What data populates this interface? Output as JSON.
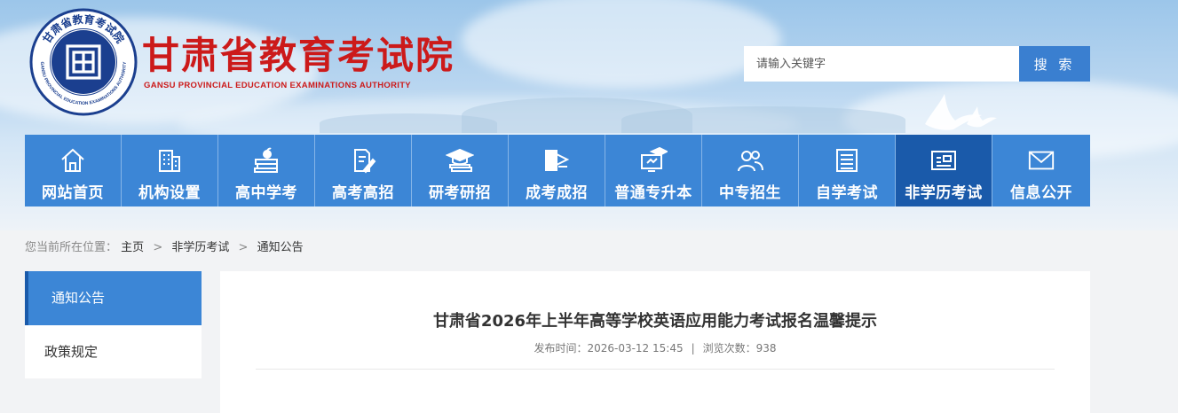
{
  "header": {
    "logo_ring_text": "甘肃省教育考试院",
    "logo_ring_text_en": "GANSU PROVINCIAL EDUCATION EXAMINATIONS AUTHORITY",
    "site_title": "甘肃省教育考试院",
    "site_subtitle": "GANSU PROVINCIAL EDUCATION EXAMINATIONS AUTHORITY",
    "brand_color": "#cc1a1a"
  },
  "search": {
    "placeholder": "请输入关键字",
    "button_label": "搜 索"
  },
  "nav": {
    "items": [
      {
        "label": "网站首页",
        "icon": "home-icon"
      },
      {
        "label": "机构设置",
        "icon": "building-icon"
      },
      {
        "label": "高中学考",
        "icon": "books-apple-icon"
      },
      {
        "label": "高考高招",
        "icon": "document-pen-icon"
      },
      {
        "label": "研考研招",
        "icon": "graduation-cap-icon"
      },
      {
        "label": "成考成招",
        "icon": "book-flag-icon"
      },
      {
        "label": "普通专升本",
        "icon": "monitor-cap-icon"
      },
      {
        "label": "中专招生",
        "icon": "users-icon"
      },
      {
        "label": "自学考试",
        "icon": "document-lines-icon"
      },
      {
        "label": "非学历考试",
        "icon": "id-card-icon",
        "active": true
      },
      {
        "label": "信息公开",
        "icon": "mail-icon"
      }
    ],
    "color": "#3c86d6",
    "active_color": "#1a5aaa"
  },
  "breadcrumb": {
    "prefix": "您当前所在位置：",
    "items": [
      "主页",
      "非学历考试",
      "通知公告"
    ],
    "separator": ">"
  },
  "sidebar": {
    "items": [
      {
        "label": "通知公告",
        "active": true
      },
      {
        "label": "政策规定",
        "active": false
      }
    ]
  },
  "article": {
    "title": "甘肃省2026年上半年高等学校英语应用能力考试报名温馨提示",
    "publish_label": "发布时间：",
    "publish_time": "2026-03-12 15:45",
    "separator": "|",
    "views_label": "浏览次数：",
    "views": "938"
  }
}
